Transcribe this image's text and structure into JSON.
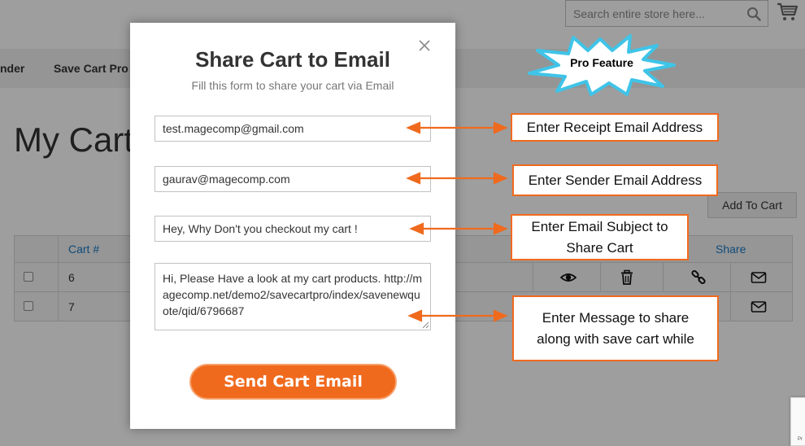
{
  "header": {
    "search_placeholder": "Search entire store here...",
    "icons": [
      "search-icon",
      "cart-icon"
    ]
  },
  "nav": {
    "items": [
      "nder",
      "Save Cart Pro"
    ]
  },
  "page": {
    "title": "My Carts",
    "add_to_cart_label": "Add To Cart"
  },
  "cart_table": {
    "headers": [
      "Cart #",
      "Share"
    ],
    "rows": [
      {
        "cart_number": "6",
        "actions": [
          "eye-icon",
          "trash-icon",
          "link-icon",
          "envelope-icon"
        ]
      },
      {
        "cart_number": "7",
        "actions": [
          "envelope-icon"
        ]
      }
    ]
  },
  "modal": {
    "title": "Share Cart to Email",
    "subtitle": "Fill this form to share your cart via Email",
    "receipt_email": "test.magecomp@gmail.com",
    "sender_email": "gaurav@magecomp.com",
    "subject": "Hey, Why Don't you checkout my cart !",
    "message": "Hi, Please Have a look at my cart products. http://magecomp.net/demo2/savecartpro/index/savenewquote/qid/6796687",
    "send_button": "Send Cart Email"
  },
  "annotations": {
    "pro_feature": "Pro Feature",
    "receipt": "Enter Receipt Email Address",
    "sender": "Enter Sender Email Address",
    "subject_line1": "Enter Email Subject to",
    "subject_line2": "Share Cart",
    "message_line1": "Enter Message to share",
    "message_line2": "along with save cart while"
  },
  "colors": {
    "accent_orange": "#f06a1e",
    "link_blue": "#1979c3",
    "starburst_cyan": "#3fc4e8"
  }
}
